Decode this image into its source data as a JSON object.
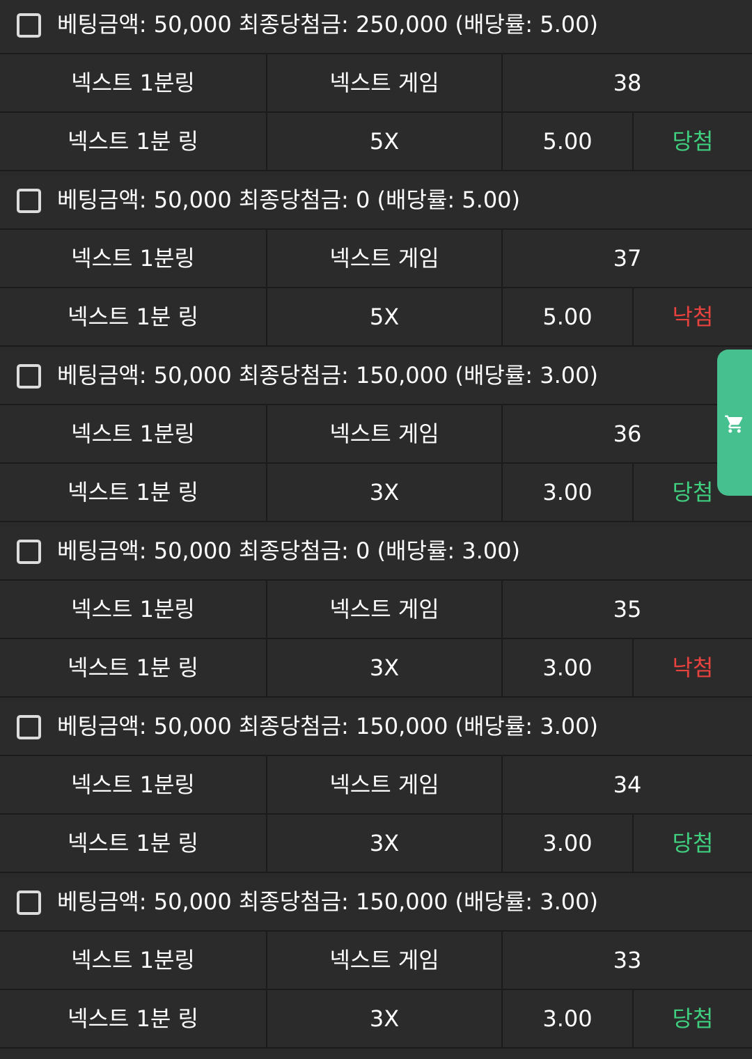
{
  "colors": {
    "background": "#2b2b2b",
    "divider": "#1b1b1b",
    "win": "#3fcf7f",
    "lose": "#e8423f",
    "cart_tab": "#46c08f"
  },
  "cart_tab": {
    "icon": "shopping-cart-icon"
  },
  "bets": [
    {
      "summary": "베팅금액: 50,000 최종당첨금: 250,000 (배당률: 5.00)",
      "game": "넥스트 1분링",
      "type": "넥스트 게임",
      "round": "38",
      "pick": "넥스트 1분 링",
      "multiplier": "5X",
      "odds": "5.00",
      "result": "당첨",
      "result_status": "win"
    },
    {
      "summary": "베팅금액: 50,000 최종당첨금: 0 (배당률: 5.00)",
      "game": "넥스트 1분링",
      "type": "넥스트 게임",
      "round": "37",
      "pick": "넥스트 1분 링",
      "multiplier": "5X",
      "odds": "5.00",
      "result": "낙첨",
      "result_status": "lose"
    },
    {
      "summary": "베팅금액: 50,000 최종당첨금: 150,000 (배당률: 3.00)",
      "game": "넥스트 1분링",
      "type": "넥스트 게임",
      "round": "36",
      "pick": "넥스트 1분 링",
      "multiplier": "3X",
      "odds": "3.00",
      "result": "당첨",
      "result_status": "win"
    },
    {
      "summary": "베팅금액: 50,000 최종당첨금: 0 (배당률: 3.00)",
      "game": "넥스트 1분링",
      "type": "넥스트 게임",
      "round": "35",
      "pick": "넥스트 1분 링",
      "multiplier": "3X",
      "odds": "3.00",
      "result": "낙첨",
      "result_status": "lose"
    },
    {
      "summary": "베팅금액: 50,000 최종당첨금: 150,000 (배당률: 3.00)",
      "game": "넥스트 1분링",
      "type": "넥스트 게임",
      "round": "34",
      "pick": "넥스트 1분 링",
      "multiplier": "3X",
      "odds": "3.00",
      "result": "당첨",
      "result_status": "win"
    },
    {
      "summary": "베팅금액: 50,000 최종당첨금: 150,000 (배당률: 3.00)",
      "game": "넥스트 1분링",
      "type": "넥스트 게임",
      "round": "33",
      "pick": "넥스트 1분 링",
      "multiplier": "3X",
      "odds": "3.00",
      "result": "당첨",
      "result_status": "win"
    }
  ]
}
